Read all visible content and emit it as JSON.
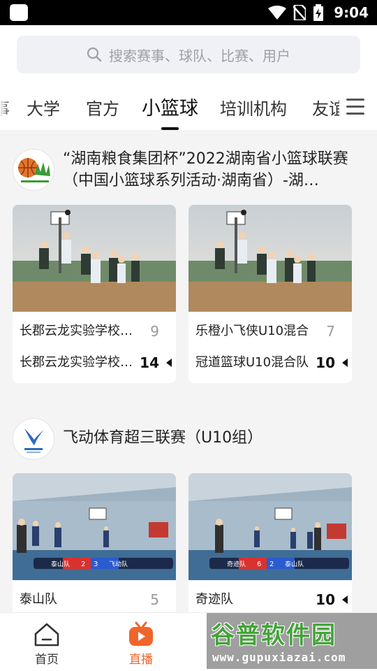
{
  "status_bar": {
    "time": "9:04"
  },
  "search": {
    "placeholder": "搜索赛事、球队、比赛、用户"
  },
  "tabs": [
    {
      "label": "事"
    },
    {
      "label": "大学"
    },
    {
      "label": "官方"
    },
    {
      "label": "小篮球",
      "active": true
    },
    {
      "label": "培训机构"
    },
    {
      "label": "友谊"
    }
  ],
  "sections": [
    {
      "title": "“湖南粮食集团杯”2022湖南省小篮球联赛（中国小篮球系列活动·湖南省）-湖…",
      "games": [
        {
          "team1": "长郡云龙实验学校…",
          "score1": "9",
          "team2": "长郡云龙实验学校…",
          "score2": "14"
        },
        {
          "team1": "乐橙小飞侠U10混合",
          "score1": "7",
          "team2": "冠道篮球U10混合队",
          "score2": "10"
        }
      ]
    },
    {
      "title": "飞动体育超三联赛（U10组）",
      "games": [
        {
          "team1": "泰山队",
          "score1": "5",
          "scoreboard": {
            "home": "泰山队",
            "home_score": "2",
            "away_score": "3",
            "away": "飞动队"
          }
        },
        {
          "team1": "奇迹队",
          "score1": "10",
          "scoreboard": {
            "home": "奇迹队",
            "home_score": "6",
            "away_score": "2",
            "away": "泰山队"
          }
        }
      ]
    }
  ],
  "bottom_nav": [
    {
      "label": "首页"
    },
    {
      "label": "直播",
      "active": true
    }
  ],
  "watermark": {
    "title": "谷普软件园",
    "url": "www.gupuxiazai.com"
  },
  "colors": {
    "accent": "#f0652a",
    "watermark_green": "#44a33a"
  }
}
